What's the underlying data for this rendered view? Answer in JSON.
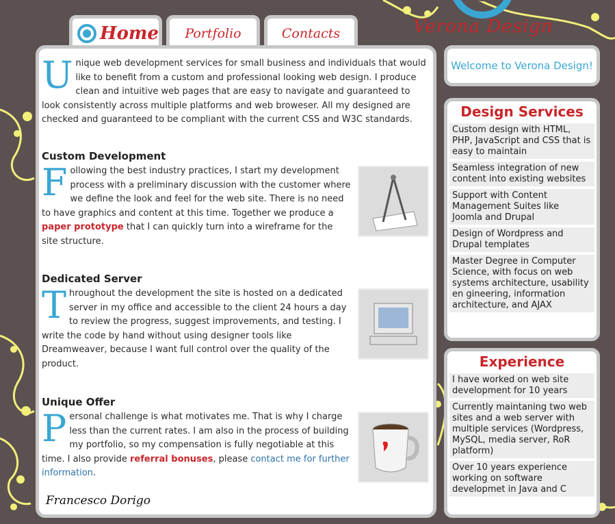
{
  "brand": {
    "name": "Verona Design"
  },
  "tabs": [
    {
      "label": "Home"
    },
    {
      "label": "Portfolio"
    },
    {
      "label": "Contacts"
    }
  ],
  "intro": {
    "drop": "U",
    "text": "nique web development services for small business and individuals that would like to benefit from a custom and professional looking web design. I produce clean and intuitive web pages that are easy to navigate and guaranteed to look consistently across multiple platforms and web broweser. All my designed are checked and guaranteed to be compliant with the current CSS and W3C standards."
  },
  "sections": [
    {
      "heading": "Custom Development",
      "drop": "F",
      "text_a": "ollowing the best industry practices, I start my development process with a preliminary discussion with the customer where we define the look and feel for the web site. There is no need to have graphics and content at this time. Together we produce a ",
      "link": "paper prototype",
      "text_b": " that I can quickly turn into a wireframe for the site structure.",
      "image": "compass-icon"
    },
    {
      "heading": "Dedicated Server",
      "drop": "T",
      "text_a": "hroughout the development the site is hosted on a dedicated server in my office and accessible to the client 24 hours a day to review the progress, suggest improvements, and testing. I write the code by hand without using designer tools like Dreamweaver, because I want full control over the quality of the product.",
      "image": "computer-icon"
    },
    {
      "heading": "Unique Offer",
      "drop": "P",
      "text_a": "ersonal challenge is what motivates me. That is why I charge less than the current rates. I am also in the process of building my portfolio, so my compensation is fully negotiable at this time. I also provide ",
      "link": "referral bonuses",
      "text_b": ", please ",
      "link2": "contact me for further information",
      "text_c": ".",
      "image": "mug-icon"
    }
  ],
  "signature": "Francesco Dorigo",
  "welcome": "Welcome to Verona Design!",
  "services": {
    "title": "Design Services",
    "items": [
      "Custom design with HTML, PHP, JavaScript and CSS that is easy to maintain",
      "Seamless integration of new content into existing websites",
      "Support with Content Management Suites like Joomla and Drupal",
      "Design of Wordpress and Drupal templates",
      "Master Degree in Computer Science, with focus on web systems architecture, usability en gineering, information architecture, and AJAX"
    ]
  },
  "experience": {
    "title": "Experience",
    "items": [
      "I have worked on web site development for 10 years",
      "Currently maintaning two web sites and a web server with multiple services (Wordpress, MySQL, media server, RoR platform)",
      "Over 10 years experience working on software developmet in Java and C"
    ]
  },
  "colors": {
    "background": "#5b5151",
    "accent_red": "#c8262b",
    "accent_blue": "#3aa6d3",
    "flourish": "#f2f07a"
  }
}
